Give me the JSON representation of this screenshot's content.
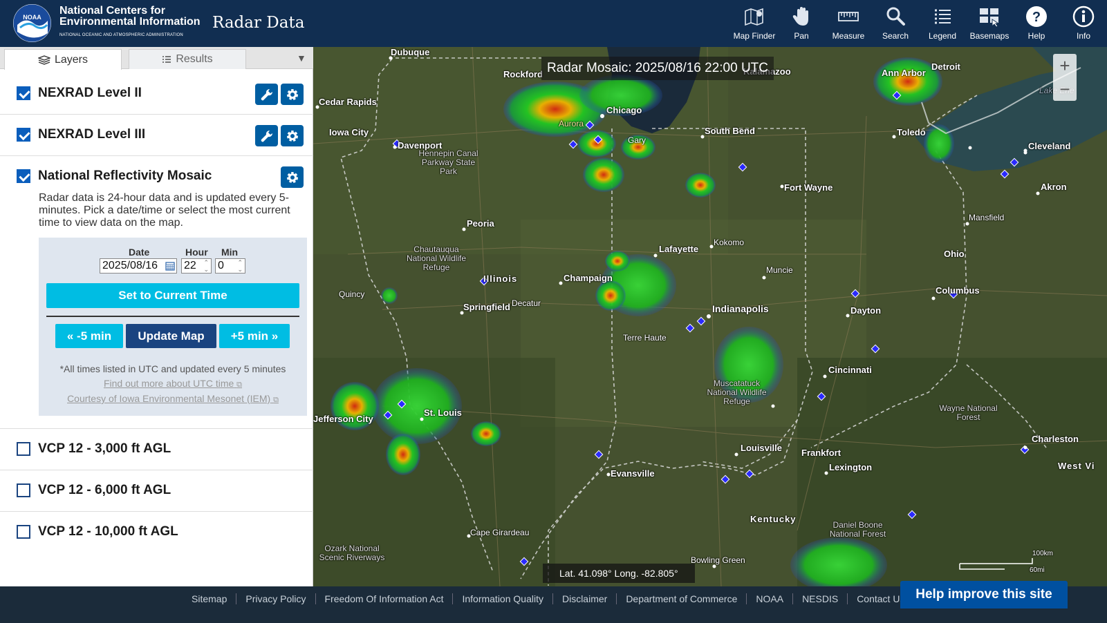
{
  "header": {
    "logo_text": "NOAA",
    "org_line1": "National Centers for",
    "org_line2": "Environmental Information",
    "org_line3": "NATIONAL OCEANIC AND ATMOSPHERIC ADMINISTRATION",
    "app_title": "Radar Data",
    "tools": [
      {
        "label": "Map Finder",
        "icon": "map-finder-icon"
      },
      {
        "label": "Pan",
        "icon": "hand-icon"
      },
      {
        "label": "Measure",
        "icon": "ruler-icon"
      },
      {
        "label": "Search",
        "icon": "search-icon"
      },
      {
        "label": "Legend",
        "icon": "list-icon"
      },
      {
        "label": "Basemaps",
        "icon": "basemaps-icon"
      },
      {
        "label": "Help",
        "icon": "help-icon"
      },
      {
        "label": "Info",
        "icon": "info-icon"
      }
    ]
  },
  "panel": {
    "tabs": [
      {
        "label": "Layers"
      },
      {
        "label": "Results"
      }
    ],
    "layers": [
      {
        "name": "NEXRAD Level II",
        "checked": true
      },
      {
        "name": "NEXRAD Level III",
        "checked": true
      },
      {
        "name": "National Reflectivity Mosaic",
        "checked": true
      },
      {
        "name": "VCP 12 - 3,000 ft AGL",
        "checked": false
      },
      {
        "name": "VCP 12 - 6,000 ft AGL",
        "checked": false
      },
      {
        "name": "VCP 12 - 10,000 ft AGL",
        "checked": false
      }
    ],
    "mosaic_description": "Radar data is 24-hour data and is updated every 5-minutes. Pick a date/time or select the most current time to view data on the map.",
    "time": {
      "date_label": "Date",
      "hour_label": "Hour",
      "min_label": "Min",
      "date_value": "2025/08/16",
      "hour_value": "22",
      "min_value": "0",
      "set_current_label": "Set to Current Time",
      "minus_label": "« -5 min",
      "update_label": "Update Map",
      "plus_label": "+5 min »",
      "note": "*All times listed in UTC and updated every 5 minutes",
      "utc_link": "Find out more about UTC time",
      "iem_link": "Courtesy of Iowa Environmental Mesonet (IEM)"
    }
  },
  "map": {
    "title": "Radar Mosaic: 2025/08/16 22:00 UTC",
    "coords": "Lat. 41.098°  Long. -82.805°",
    "scale_top": "100km",
    "scale_bottom": "60mi",
    "places": [
      {
        "text": "Dubuque",
        "cls": "big"
      },
      {
        "text": "Rockford",
        "cls": "big"
      },
      {
        "text": "Kalamazoo",
        "cls": "big"
      },
      {
        "text": "Ann Arbor",
        "cls": "big"
      },
      {
        "text": "Detroit",
        "cls": "big"
      },
      {
        "text": "Lake Erie",
        "cls": ""
      },
      {
        "text": "Cedar Rapids",
        "cls": "big"
      },
      {
        "text": "Chicago",
        "cls": "big"
      },
      {
        "text": "Aurora",
        "cls": ""
      },
      {
        "text": "Iowa City",
        "cls": "big"
      },
      {
        "text": "South Bend",
        "cls": "big"
      },
      {
        "text": "Toledo",
        "cls": "big"
      },
      {
        "text": "Cleveland",
        "cls": "big"
      },
      {
        "text": "Davenport",
        "cls": "big"
      },
      {
        "text": "Gary",
        "cls": ""
      },
      {
        "text": "Hennepin Canal Parkway State Park",
        "cls": "area"
      },
      {
        "text": "Fort Wayne",
        "cls": "big"
      },
      {
        "text": "Akron",
        "cls": "big"
      },
      {
        "text": "Mansfield",
        "cls": ""
      },
      {
        "text": "Peoria",
        "cls": "big"
      },
      {
        "text": "Kokomo",
        "cls": ""
      },
      {
        "text": "Chautauqua National Wildlife Refuge",
        "cls": "area"
      },
      {
        "text": "Lafayette",
        "cls": "big"
      },
      {
        "text": "Ohio",
        "cls": "big"
      },
      {
        "text": "Muncie",
        "cls": ""
      },
      {
        "text": "Illinois",
        "cls": "big"
      },
      {
        "text": "Champaign",
        "cls": "big"
      },
      {
        "text": "Columbus",
        "cls": "big"
      },
      {
        "text": "Quincy",
        "cls": ""
      },
      {
        "text": "Springfield",
        "cls": "big"
      },
      {
        "text": "Decatur",
        "cls": ""
      },
      {
        "text": "Indianapolis",
        "cls": "big"
      },
      {
        "text": "Dayton",
        "cls": "big"
      },
      {
        "text": "Terre Haute",
        "cls": ""
      },
      {
        "text": "Cincinnati",
        "cls": "big"
      },
      {
        "text": "Muscatatuck National Wildlife Refuge",
        "cls": "area"
      },
      {
        "text": "St. Louis",
        "cls": "big"
      },
      {
        "text": "Jefferson City",
        "cls": "big"
      },
      {
        "text": "Wayne National Forest",
        "cls": "area"
      },
      {
        "text": "Louisville",
        "cls": "big"
      },
      {
        "text": "Frankfort",
        "cls": "big"
      },
      {
        "text": "Charleston",
        "cls": "big"
      },
      {
        "text": "West Vi",
        "cls": "big"
      },
      {
        "text": "Lexington",
        "cls": "big"
      },
      {
        "text": "Evansville",
        "cls": "big"
      },
      {
        "text": "Kentucky",
        "cls": "big"
      },
      {
        "text": "Daniel Boone National Forest",
        "cls": "area"
      },
      {
        "text": "Cape Girardeau",
        "cls": ""
      },
      {
        "text": "Ozark National Scenic Riverways",
        "cls": "area"
      },
      {
        "text": "Bowling Green",
        "cls": ""
      }
    ]
  },
  "footer": {
    "links": [
      "Sitemap",
      "Privacy Policy",
      "Freedom Of Information Act",
      "Information Quality",
      "Disclaimer",
      "Department of Commerce",
      "NOAA",
      "NESDIS",
      "Contact Us"
    ],
    "feedback_label": "Help improve this site"
  }
}
